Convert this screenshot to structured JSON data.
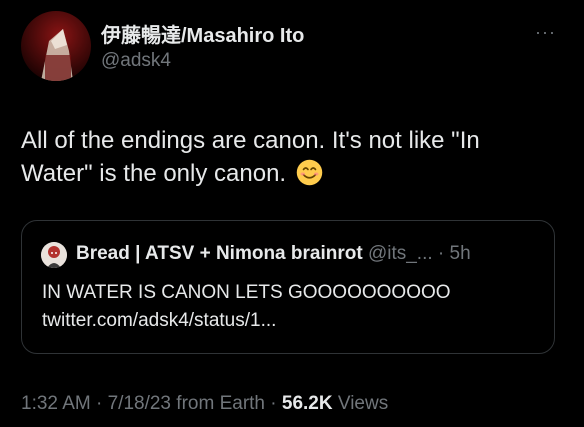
{
  "author": {
    "display_name": "伊藤暢達/Masahiro Ito",
    "handle": "@adsk4",
    "avatar": "pyramid-head-avatar"
  },
  "more_icon": "···",
  "tweet": {
    "line1": "All of the endings are canon. It's not like \"In",
    "line2": "Water\" is the only canon.",
    "emoji": "smiling-face-emoji"
  },
  "quote": {
    "name": "Bread | ATSV + Nimona brainrot",
    "handle": "@its_...",
    "separator": " · ",
    "time": "5h",
    "line1": "IN WATER IS CANON LETS GOOOOOOOOOO",
    "line2": "twitter.com/adsk4/status/1..."
  },
  "footer": {
    "time": "1:32 AM",
    "sep1": " · ",
    "date": "7/18/23",
    "source": " from Earth",
    "sep2": " · ",
    "views_count": "56.2K",
    "views_label": " Views"
  },
  "colors": {
    "background": "#000000",
    "text_primary": "#e7e9ea",
    "text_secondary": "#71767b",
    "border": "#2f3336"
  }
}
